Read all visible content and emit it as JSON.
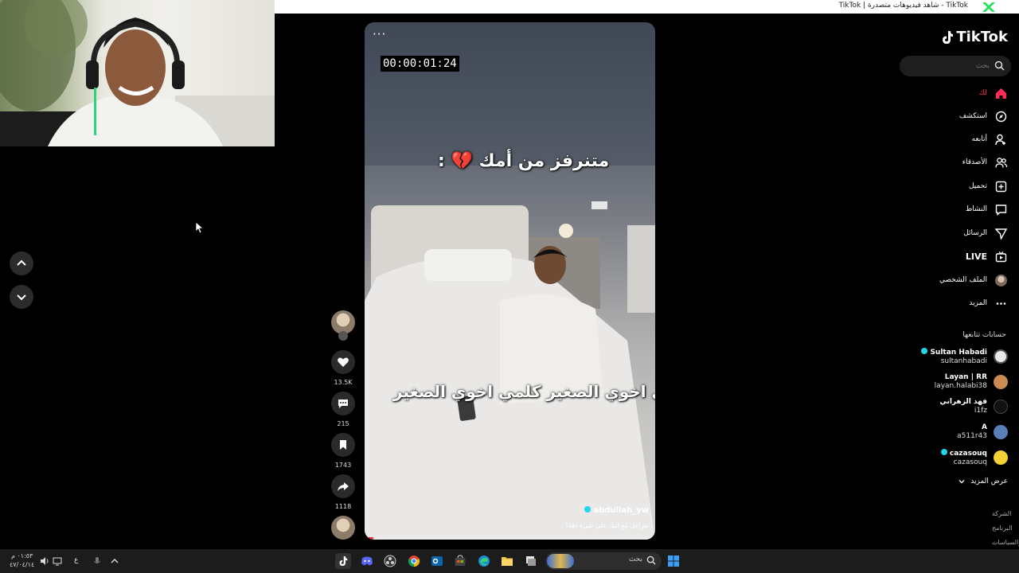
{
  "window": {
    "title": "TikTok | شاهد فيديوهات متصدرة - TikTok"
  },
  "video": {
    "menu_label": "···",
    "timecode": "00:00:01:24",
    "caption_top": "متنرفز من أمك 💔 :",
    "caption_mid": "كلمي اخوي الصغير كلمي اخوي الصغير",
    "author": "abdullah_yw",
    "description": "تعراعل مع امك على شيء دقة؟",
    "progress": 0.03
  },
  "actions": {
    "likes": "13.5K",
    "comments": "215",
    "saves": "1743",
    "shares": "1118"
  },
  "sidebar": {
    "brand": "TikTok",
    "search_placeholder": "بحث",
    "nav": [
      {
        "label": "لك",
        "icon": "home-icon",
        "active": true
      },
      {
        "label": "استكشف",
        "icon": "compass-icon",
        "active": false
      },
      {
        "label": "أتابعه",
        "icon": "user-follow-icon",
        "active": false
      },
      {
        "label": "الأصدقاء",
        "icon": "friends-icon",
        "active": false
      },
      {
        "label": "تحميل",
        "icon": "upload-icon",
        "active": false
      },
      {
        "label": "النشاط",
        "icon": "activity-icon",
        "active": false
      },
      {
        "label": "الرسائل",
        "icon": "messages-icon",
        "active": false
      },
      {
        "label": "LIVE",
        "icon": "live-icon",
        "active": false
      },
      {
        "label": "الملف الشخصي",
        "icon": "profile-avatar",
        "active": false
      },
      {
        "label": "المزيد",
        "icon": "more-icon",
        "active": false
      }
    ],
    "following_title": "حسابات تتابعها",
    "accounts": [
      {
        "name": "Sultan Habadi",
        "handle": "sultanhabadi",
        "verified": true
      },
      {
        "name": "Layan | RR",
        "handle": "layan.halabi38",
        "verified": false
      },
      {
        "name": "فهد الزهراني",
        "handle": "i1fz",
        "verified": false
      },
      {
        "name": "A",
        "handle": "a511r43",
        "verified": false
      },
      {
        "name": "cazasouq",
        "handle": "cazasouq",
        "verified": true
      }
    ],
    "see_more": "عرض المزيد",
    "footer": [
      "الشركة",
      "البرنامج",
      "الشروط والسياسات"
    ]
  },
  "taskbar": {
    "search_label": "بحث",
    "lang": "ع",
    "time": "٠١:٥٣ م",
    "date": "٤٧/٠٤/١٤"
  },
  "colors": {
    "accent": "#fe2c55",
    "verified": "#20d5ec"
  }
}
